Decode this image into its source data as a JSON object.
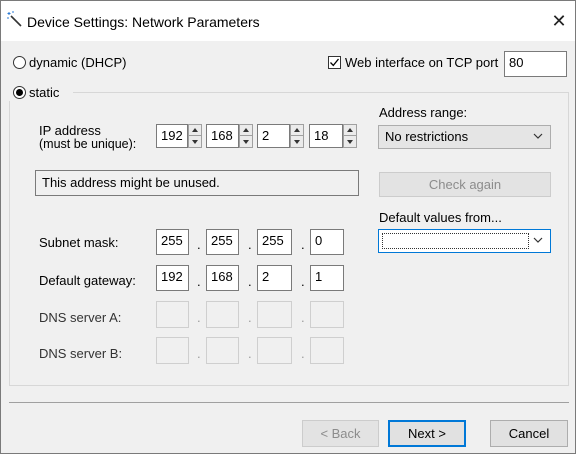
{
  "window": {
    "title": "Device Settings: Network Parameters",
    "close_label": "✕"
  },
  "mode": {
    "dynamic_label": "dynamic (DHCP)",
    "dynamic_selected": false,
    "static_label": "static",
    "static_selected": true
  },
  "web_interface": {
    "label": "Web interface on TCP port",
    "checked": true,
    "port": "80"
  },
  "ip_address": {
    "label_line1": "IP address",
    "label_line2": "(must be unique):",
    "octets": [
      "192",
      "168",
      "2",
      "18"
    ]
  },
  "address_status": "This address might be unused.",
  "address_range": {
    "label": "Address range:",
    "selected": "No restrictions"
  },
  "check_again_label": "Check again",
  "default_values": {
    "label": "Default values from...",
    "selected": ""
  },
  "subnet_mask": {
    "label": "Subnet mask:",
    "octets": [
      "255",
      "255",
      "255",
      "0"
    ]
  },
  "default_gateway": {
    "label": "Default gateway:",
    "octets": [
      "192",
      "168",
      "2",
      "1"
    ]
  },
  "dns_a": {
    "label": "DNS server A:",
    "octets": [
      "",
      "",
      "",
      ""
    ]
  },
  "dns_b": {
    "label": "DNS server B:",
    "octets": [
      "",
      "",
      "",
      ""
    ]
  },
  "separator": ".",
  "buttons": {
    "back": "< Back",
    "next": "Next >",
    "cancel": "Cancel"
  },
  "colors": {
    "focus_border": "#0078d7",
    "window_bg": "#f0f0f0"
  }
}
